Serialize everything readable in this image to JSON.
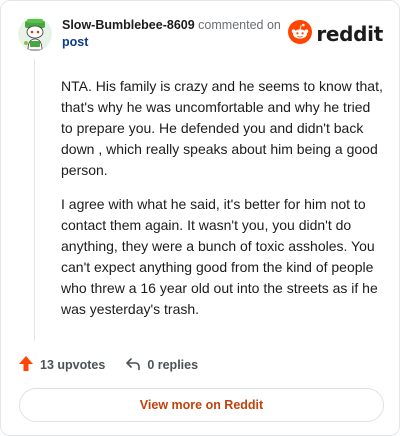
{
  "header": {
    "username": "Slow-Bumblebee-8609",
    "action_text": "commented on",
    "post_link": "post",
    "brand": "reddit",
    "avatar_icon": "snoo-avatar-icon",
    "brand_icon": "reddit-logo-icon"
  },
  "comment": {
    "paragraphs": [
      "NTA. His family is crazy and he seems to know that, that's why he was uncomfortable and why he tried to prepare you. He defended you and didn't back down , which really speaks about him being a good person.",
      "I agree with what he said, it's better for him not to contact them again. It wasn't you, you didn't do anything, they were a bunch of toxic assholes. You can't expect anything good from the kind of people who threw a 16 year old out into the streets as if he was yesterday's trash."
    ]
  },
  "actions": {
    "upvotes": "13 upvotes",
    "replies": "0 replies",
    "upvote_icon": "upvote-arrow-icon",
    "reply_icon": "reply-arrow-icon"
  },
  "footer": {
    "view_more": "View more on Reddit"
  },
  "colors": {
    "brand_orange": "#ff4500",
    "link_blue": "#0b3b8a",
    "view_more_text": "#c1420b"
  }
}
